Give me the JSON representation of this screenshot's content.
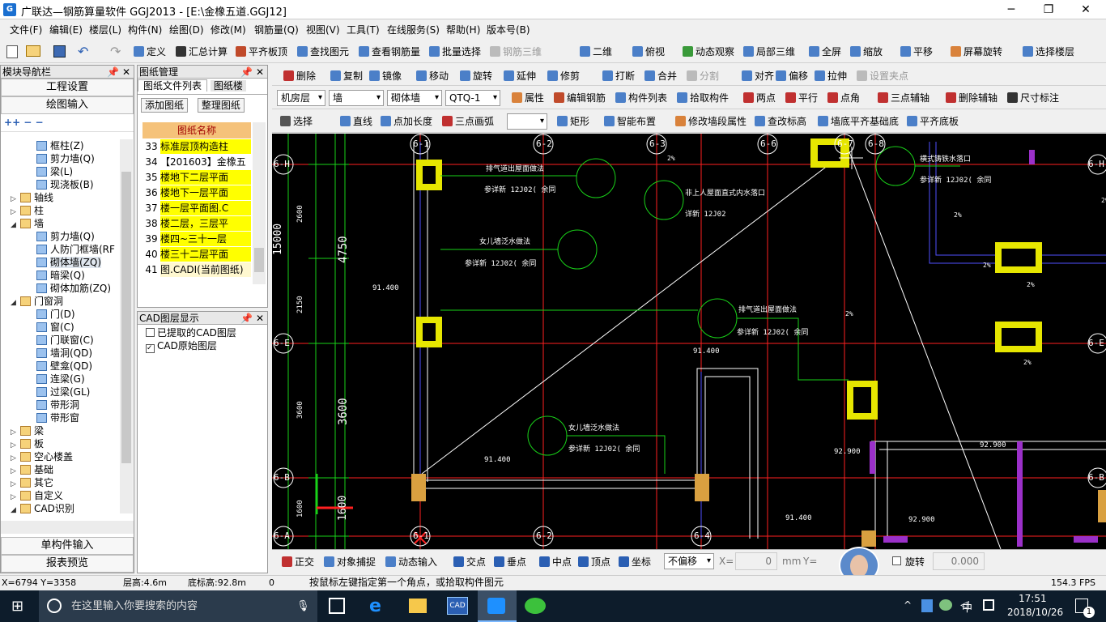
{
  "window": {
    "title": "广联达—钢筋算量软件 GGJ2013 - [E:\\金橡五道.GGJ12]"
  },
  "menu": [
    "文件(F)",
    "编辑(E)",
    "楼层(L)",
    "构件(N)",
    "绘图(D)",
    "修改(M)",
    "钢筋量(Q)",
    "视图(V)",
    "工具(T)",
    "在线服务(S)",
    "帮助(H)",
    "版本号(B)"
  ],
  "toolbar1": [
    "定义",
    "汇总计算",
    "平齐板顶",
    "查找图元",
    "查看钢筋量",
    "批量选择",
    "钢筋三维",
    "二维",
    "俯视",
    "动态观察",
    "局部三维",
    "全屏",
    "缩放",
    "平移",
    "屏幕旋转",
    "选择楼层"
  ],
  "toolbar2": [
    "删除",
    "复制",
    "镜像",
    "移动",
    "旋转",
    "延伸",
    "修剪",
    "打断",
    "合并",
    "分割",
    "对齐",
    "偏移",
    "拉伸",
    "设置夹点"
  ],
  "toolbar3": {
    "floor": "机房层",
    "type": "墙",
    "subtype": "砌体墙",
    "item": "QTQ-1",
    "buttons": [
      "属性",
      "编辑钢筋",
      "构件列表",
      "拾取构件",
      "两点",
      "平行",
      "点角",
      "三点辅轴",
      "删除辅轴",
      "尺寸标注"
    ]
  },
  "toolbar4": [
    "选择",
    "直线",
    "点加长度",
    "三点画弧",
    "矩形",
    "智能布置",
    "修改墙段属性",
    "查改标高",
    "墙底平齐基础底",
    "平齐底板"
  ],
  "nav": {
    "title": "模块导航栏",
    "sections": [
      "工程设置",
      "绘图输入",
      "单构件输入",
      "报表预览"
    ],
    "tree": [
      {
        "label": "框柱(Z)",
        "level": 2,
        "icon": "blue"
      },
      {
        "label": "剪力墙(Q)",
        "level": 2,
        "icon": "blue"
      },
      {
        "label": "梁(L)",
        "level": 2,
        "icon": "blue"
      },
      {
        "label": "现浇板(B)",
        "level": 2,
        "icon": "blue"
      },
      {
        "label": "轴线",
        "level": 1,
        "icon": "folder"
      },
      {
        "label": "柱",
        "level": 1,
        "icon": "folder"
      },
      {
        "label": "墙",
        "level": 1,
        "icon": "folder"
      },
      {
        "label": "剪力墙(Q)",
        "level": 2,
        "icon": "blue"
      },
      {
        "label": "人防门框墙(RF",
        "level": 2,
        "icon": "blue"
      },
      {
        "label": "砌体墙(ZQ)",
        "level": 2,
        "icon": "blue"
      },
      {
        "label": "暗梁(Q)",
        "level": 2,
        "icon": "blue"
      },
      {
        "label": "砌体加筋(ZQ)",
        "level": 2,
        "icon": "blue"
      },
      {
        "label": "门窗洞",
        "level": 1,
        "icon": "folder"
      },
      {
        "label": "门(D)",
        "level": 2,
        "icon": "blue"
      },
      {
        "label": "窗(C)",
        "level": 2,
        "icon": "blue"
      },
      {
        "label": "门联窗(C)",
        "level": 2,
        "icon": "blue"
      },
      {
        "label": "墙洞(QD)",
        "level": 2,
        "icon": "blue"
      },
      {
        "label": "壁龛(QD)",
        "level": 2,
        "icon": "blue"
      },
      {
        "label": "连梁(G)",
        "level": 2,
        "icon": "blue"
      },
      {
        "label": "过梁(GL)",
        "level": 2,
        "icon": "blue"
      },
      {
        "label": "带形洞",
        "level": 2,
        "icon": "blue"
      },
      {
        "label": "带形窗",
        "level": 2,
        "icon": "blue"
      },
      {
        "label": "梁",
        "level": 1,
        "icon": "folder"
      },
      {
        "label": "板",
        "level": 1,
        "icon": "folder"
      },
      {
        "label": "空心楼盖",
        "level": 1,
        "icon": "folder"
      },
      {
        "label": "基础",
        "level": 1,
        "icon": "folder"
      },
      {
        "label": "其它",
        "level": 1,
        "icon": "folder"
      },
      {
        "label": "自定义",
        "level": 1,
        "icon": "folder"
      },
      {
        "label": "CAD识别",
        "level": 1,
        "icon": "folder"
      }
    ]
  },
  "drawings": {
    "title": "图纸管理",
    "tabs": [
      "图纸文件列表",
      "图纸楼"
    ],
    "buttons": [
      "添加图纸",
      "整理图纸"
    ],
    "col_header": "图纸名称",
    "rows": [
      {
        "num": "33",
        "name": "标准层顶构造柱"
      },
      {
        "num": "34",
        "name": "【201603】金橡五"
      },
      {
        "num": "35",
        "name": "楼地下二层平面"
      },
      {
        "num": "36",
        "name": "楼地下一层平面"
      },
      {
        "num": "37",
        "name": "楼一层平面图.C"
      },
      {
        "num": "38",
        "name": "楼二层，三层平"
      },
      {
        "num": "39",
        "name": "楼四~三十一层"
      },
      {
        "num": "40",
        "name": "楼三十二层平面"
      },
      {
        "num": "41",
        "name": "图.CADI(当前图纸)"
      }
    ]
  },
  "cadlayers": {
    "title": "CAD图层显示",
    "items": [
      "已提取的CAD图层",
      "CAD原始图层"
    ]
  },
  "cad": {
    "axes_top": [
      "6-1",
      "6-2",
      "6-3",
      "6-6",
      "6-7",
      "6-8"
    ],
    "axes_bottom": [
      "6-1",
      "6-2",
      "6-4"
    ],
    "axes_left": [
      "6-H",
      "6-E",
      "6-B",
      "6-A"
    ],
    "axes_right": [
      "6-H",
      "6-E",
      "6-B"
    ],
    "dims": [
      "15000",
      "4750",
      "3600",
      "2600",
      "2150",
      "3600",
      "1600",
      "1600"
    ],
    "labels": [
      "排气道出屋面做法",
      "参详新  12J02(  余同",
      "非上人屋面直式内水落口",
      "详新  12J02",
      "女儿墙泛水做法",
      "参详新  12J02(  余同",
      "排气道出屋面做法",
      "参详新  12J02(  余同",
      "女儿墙泛水做法",
      "参详新  12J02(  余同",
      "横式铸铁水落口",
      "参详新  12J02(  余同"
    ],
    "levels": [
      "91.400",
      "91.400",
      "91.400",
      "91.400",
      "92.900",
      "92.900",
      "92.900"
    ],
    "slopes": [
      "2%",
      "2%",
      "2%",
      "2%",
      "2%",
      "2%",
      "2%"
    ]
  },
  "snapbar": [
    "正交",
    "对象捕捉",
    "动态输入",
    "交点",
    "垂点",
    "中点",
    "顶点",
    "坐标"
  ],
  "snap": {
    "offset": "不偏移",
    "x_label": "X=",
    "x_val": "0",
    "unit": "mm",
    "y_label": "Y=",
    "rotate": "旋转",
    "angle": "0.000"
  },
  "statusbar": {
    "coords": "X=6794 Y=3358",
    "floor_h": "层高:4.6m",
    "bottom": "底标高:92.8m",
    "zero": "0",
    "hint": "按鼠标左键指定第一个角点，或拾取构件图元",
    "fps": "154.3 FPS"
  },
  "taskbar": {
    "search": "在这里输入你要搜索的内容",
    "time": "17:51",
    "date": "2018/10/26",
    "ime": "中",
    "notif": "1"
  }
}
